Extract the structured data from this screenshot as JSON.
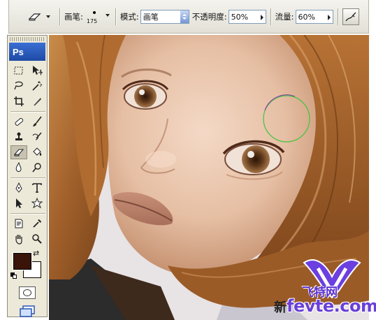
{
  "options_bar": {
    "brush_label": "画笔:",
    "brush_size": "175",
    "mode_label": "模式:",
    "mode_value": "画笔",
    "opacity_label": "不透明度:",
    "opacity_value": "50%",
    "flow_label": "流量:",
    "flow_value": "60%"
  },
  "toolbox": {
    "logo": "Ps",
    "foreground_color": "#3a1408",
    "background_color": "#ffffff"
  },
  "watermark": {
    "brand_cn": "飞特网",
    "domain": "fevte.com",
    "prefix_char": "新"
  }
}
